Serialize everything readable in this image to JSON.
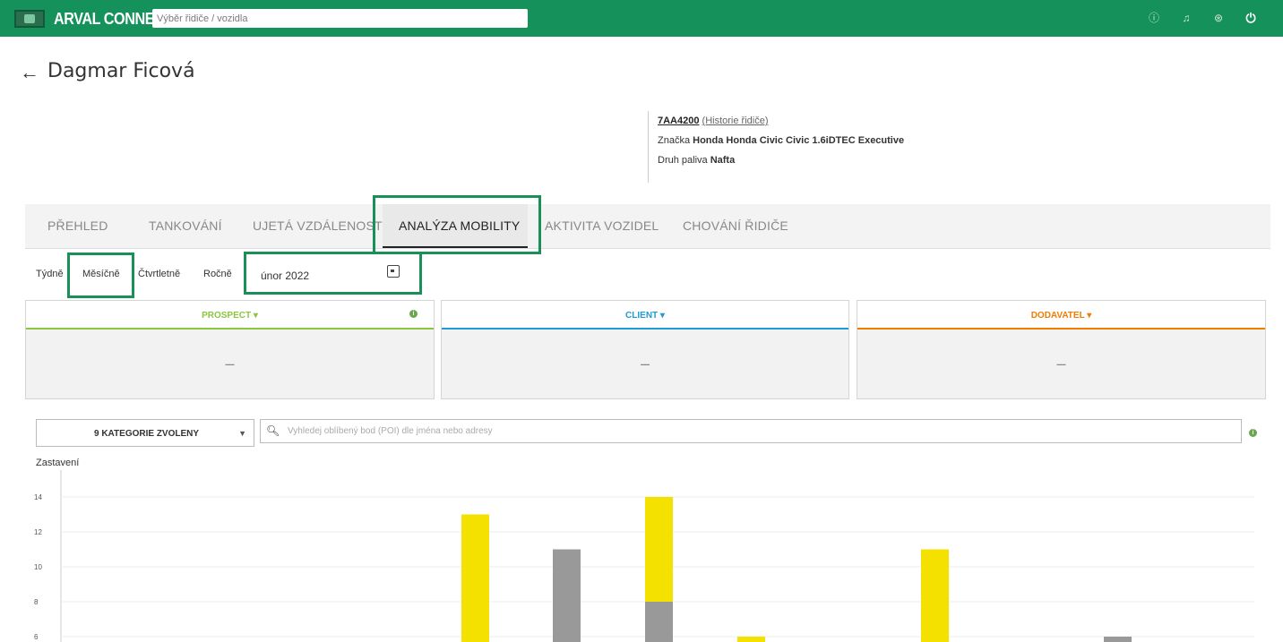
{
  "header": {
    "brand": "ARVAL CONNECT",
    "search_placeholder": "Výběr řidiče / vozidla",
    "icons": [
      "info-icon",
      "bell-icon",
      "user-icon",
      "power-icon"
    ]
  },
  "driver": {
    "back": "←",
    "name": "Dagmar Ficová"
  },
  "vehicle": {
    "plate": "7AA4200",
    "history_link": "(Historie řidiče)",
    "brand_label": "Značka",
    "brand_value": "Honda Honda Civic Civic 1.6iDTEC Executive",
    "fuel_label": "Druh paliva",
    "fuel_value": "Nafta"
  },
  "tabs": [
    {
      "label": "PŘEHLED"
    },
    {
      "label": "TANKOVÁNÍ"
    },
    {
      "label": "UJETÁ VZDÁLENOST"
    },
    {
      "label": "ANALÝZA MOBILITY",
      "active": true
    },
    {
      "label": "AKTIVITA VOZIDEL"
    },
    {
      "label": "CHOVÁNÍ ŘIDIČE"
    }
  ],
  "period": {
    "options": [
      "Týdně",
      "Měsíčně",
      "Čtvrtletně",
      "Ročně"
    ],
    "selected": "Měsíčně",
    "date": "únor 2022"
  },
  "cards": [
    {
      "title": "PROSPECT ▾",
      "value": "–",
      "color": "#8cc63f"
    },
    {
      "title": "CLIENT ▾",
      "value": "–",
      "color": "#1e9ad6"
    },
    {
      "title": "DODAVATEL ▾",
      "value": "–",
      "color": "#f07d00"
    }
  ],
  "filters": {
    "categories_label": "9 KATEGORIE ZVOLENY",
    "poi_placeholder": "Vyhledej oblíbený bod (POI) dle jména nebo adresy"
  },
  "chart_data": {
    "type": "bar",
    "ylabel": "Zastavení",
    "y_ticks": [
      6,
      8,
      10,
      12,
      14
    ],
    "stacks": [
      {
        "gray": 0,
        "yellow": 13
      },
      {
        "gray": 11,
        "yellow": 0
      },
      {
        "gray": 8,
        "yellow": 6
      },
      {
        "gray": 0,
        "yellow": 6
      },
      {
        "gray": 0,
        "yellow": 11
      },
      {
        "gray": 6,
        "yellow": 0
      }
    ],
    "colors": {
      "gray": "#999999",
      "yellow": "#f5e100",
      "grid": "#eeeeee"
    }
  }
}
